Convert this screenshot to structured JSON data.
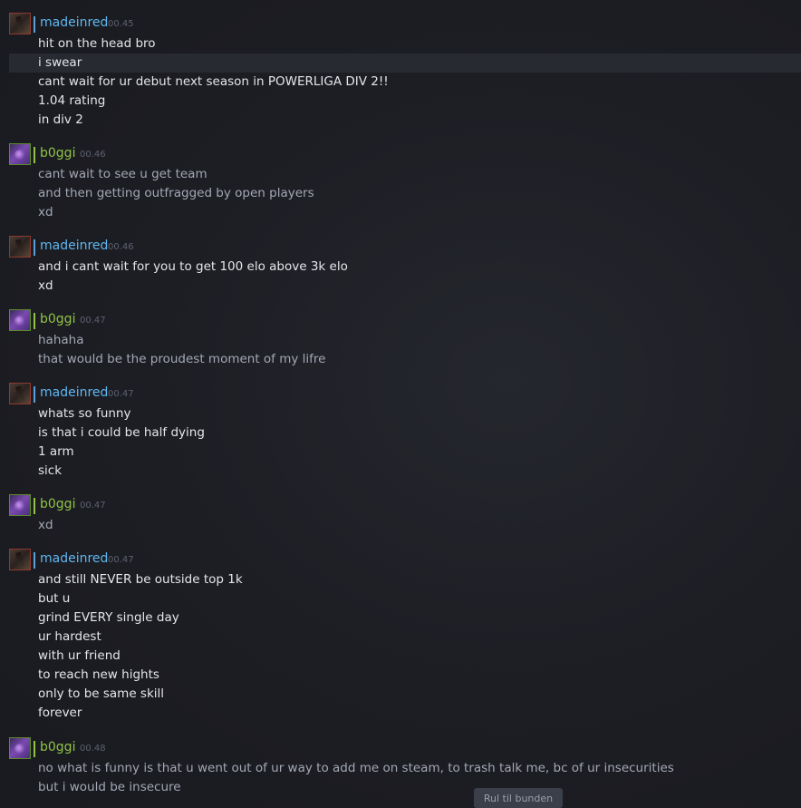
{
  "chat": {
    "groups": [
      {
        "user": "madeinred",
        "time": "00.45",
        "lines": [
          "hit on the head bro",
          "i swear",
          "cant wait for ur debut next season in POWERLIGA DIV 2!!",
          "1.04 rating",
          "in div 2"
        ]
      },
      {
        "user": "b0ggi",
        "time": "00.46",
        "lines": [
          "cant wait to see u get team",
          "and then getting outfragged by open players",
          "xd"
        ]
      },
      {
        "user": "madeinred",
        "time": "00.46",
        "lines": [
          "and i cant wait for you to get 100 elo above 3k elo",
          "xd"
        ]
      },
      {
        "user": "b0ggi",
        "time": "00.47",
        "lines": [
          "hahaha",
          "that would be the proudest moment of my lifre"
        ]
      },
      {
        "user": "madeinred",
        "time": "00.47",
        "lines": [
          "whats so funny",
          "is that i could be half dying",
          "1 arm",
          "sick"
        ]
      },
      {
        "user": "b0ggi",
        "time": "00.47",
        "lines": [
          "xd"
        ]
      },
      {
        "user": "madeinred",
        "time": "00.47",
        "lines": [
          "and still NEVER be outside top 1k",
          "but u",
          "grind EVERY single day",
          "ur hardest",
          "with ur friend",
          "to reach new hights",
          "only to be same skill",
          "forever"
        ]
      },
      {
        "user": "b0ggi",
        "time": "00.48",
        "lines": [
          "no what is funny is that u went out of ur way to add me on steam, to trash talk me, bc of ur insecurities",
          "but i would be insecure"
        ]
      }
    ]
  },
  "jump_button": {
    "label": "Rul til bunden"
  },
  "colors": {
    "friend_name": "#5fb7f0",
    "self_name": "#8fc346",
    "friend_text": "#e4e6ea",
    "self_text": "#a3a8b4",
    "background": "#1d1e24"
  },
  "icons": {
    "friend_avatar": "avatar-madeinred",
    "self_avatar": "avatar-b0ggi"
  }
}
